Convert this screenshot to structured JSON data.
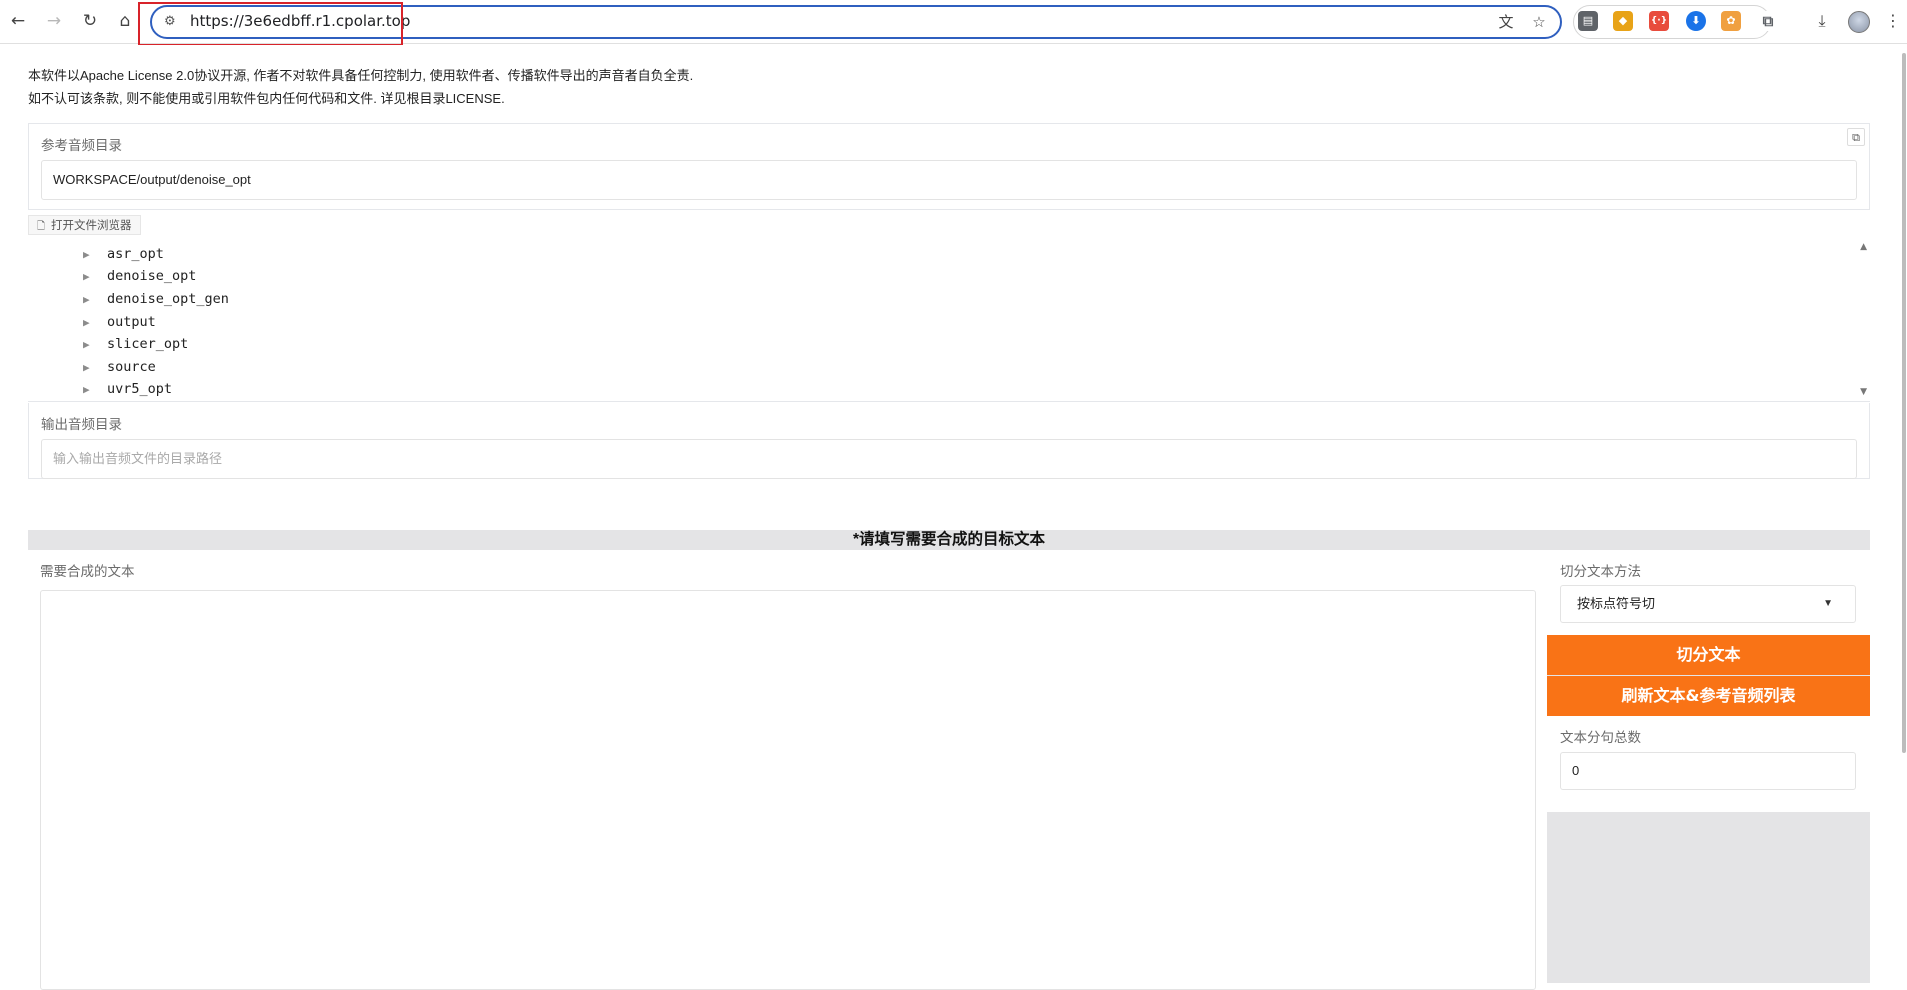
{
  "browser": {
    "url": "https://3e6edbff.r1.cpolar.top",
    "nav": {
      "back_icon": "←",
      "forward_icon": "→",
      "reload_icon": "↻",
      "home_icon": "⌂"
    },
    "omnibox_icons": {
      "site_settings_icon": "⚙",
      "translate_icon": "文",
      "bookmark_icon": "☆"
    },
    "extensions": [
      {
        "name": "reading-list-icon",
        "glyph": "▤",
        "color": "#5f6368"
      },
      {
        "name": "shield-extension-icon",
        "glyph": "◆",
        "color": "#e8a317"
      },
      {
        "name": "red-extension-icon",
        "glyph": "{·}",
        "color": "#e84c3d"
      },
      {
        "name": "blue-download-extension-icon",
        "glyph": "⬇",
        "color": "#1a73e8"
      },
      {
        "name": "cat-extension-icon",
        "glyph": "✿",
        "color": "#f0a040"
      },
      {
        "name": "puzzle-extensions-icon",
        "glyph": "⧉",
        "color": "#5f6368"
      }
    ],
    "download_icon": "⤓",
    "menu_icon": "⋮"
  },
  "notice": {
    "line1": "本软件以Apache License 2.0协议开源, 作者不对软件具备任何控制力, 使用软件者、传播软件导出的声音者自负全责.",
    "line2": "如不认可该条款, 则不能使用或引用软件包内任何代码和文件. 详见根目录LICENSE."
  },
  "ref_audio_dir": {
    "label": "参考音频目录",
    "value": "WORKSPACE/output/denoise_opt",
    "copy_icon": "⧉"
  },
  "file_browser": {
    "tab_label": "打开文件浏览器",
    "tab_icon": "🗋",
    "items": [
      "asr_opt",
      "denoise_opt",
      "denoise_opt_gen",
      "output",
      "slicer_opt",
      "source",
      "uvr5_opt"
    ],
    "arrow": "▶",
    "scroll_up": "▲",
    "scroll_down": "▼"
  },
  "output_audio_dir": {
    "label": "输出音频目录",
    "placeholder": "输入输出音频文件的目录路径"
  },
  "section_title": "*请填写需要合成的目标文本",
  "target_text": {
    "label": "需要合成的文本",
    "value": ""
  },
  "split": {
    "method_label": "切分文本方法",
    "method_value": "按标点符号切",
    "split_button": "切分文本",
    "refresh_button": "刷新文本&参考音频列表",
    "count_label": "文本分句总数",
    "count_value": "0"
  },
  "colors": {
    "accent": "#f97316",
    "url_highlight": "#d8232a",
    "omnibox_border": "#2f5fbf"
  }
}
